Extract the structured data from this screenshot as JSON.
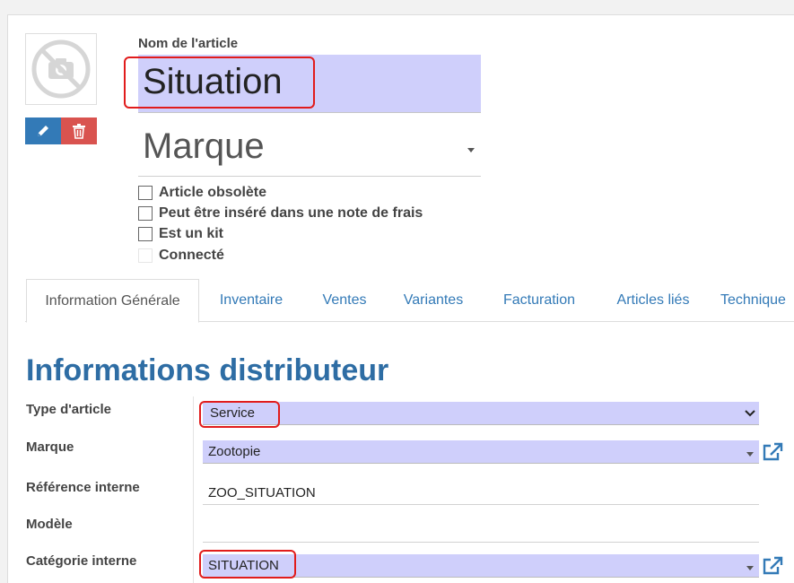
{
  "product": {
    "name_label": "Nom de l'article",
    "name_value": "Situation",
    "brand_placeholder": "Marque",
    "checkboxes": [
      {
        "label": "Article obsolète",
        "checked": false
      },
      {
        "label": "Peut être inséré dans une note de frais",
        "checked": false
      },
      {
        "label": "Est un kit",
        "checked": false
      },
      {
        "label": "Connecté",
        "checked": false
      }
    ]
  },
  "image": {
    "placeholder_icon": "no-camera-icon",
    "edit_icon": "pencil-icon",
    "delete_icon": "trash-icon"
  },
  "tabs": [
    {
      "label": "Information Générale",
      "active": true
    },
    {
      "label": "Inventaire",
      "active": false
    },
    {
      "label": "Ventes",
      "active": false
    },
    {
      "label": "Variantes",
      "active": false
    },
    {
      "label": "Facturation",
      "active": false
    },
    {
      "label": "Articles liés",
      "active": false
    },
    {
      "label": "Technique",
      "active": false
    }
  ],
  "section": {
    "title": "Informations distributeur",
    "fields": [
      {
        "label": "Type d'article",
        "value": "Service"
      },
      {
        "label": "Marque",
        "value": "Zootopie"
      },
      {
        "label": "Référence interne",
        "value": "ZOO_SITUATION"
      },
      {
        "label": "Modèle",
        "value": ""
      },
      {
        "label": "Catégorie interne",
        "value": "SITUATION"
      }
    ]
  },
  "colors": {
    "field_highlight": "#cfcffb",
    "link_blue": "#337ab7",
    "title_blue": "#2e6da4",
    "delete_red": "#d9534f",
    "annotation_red": "#e11c1c"
  }
}
